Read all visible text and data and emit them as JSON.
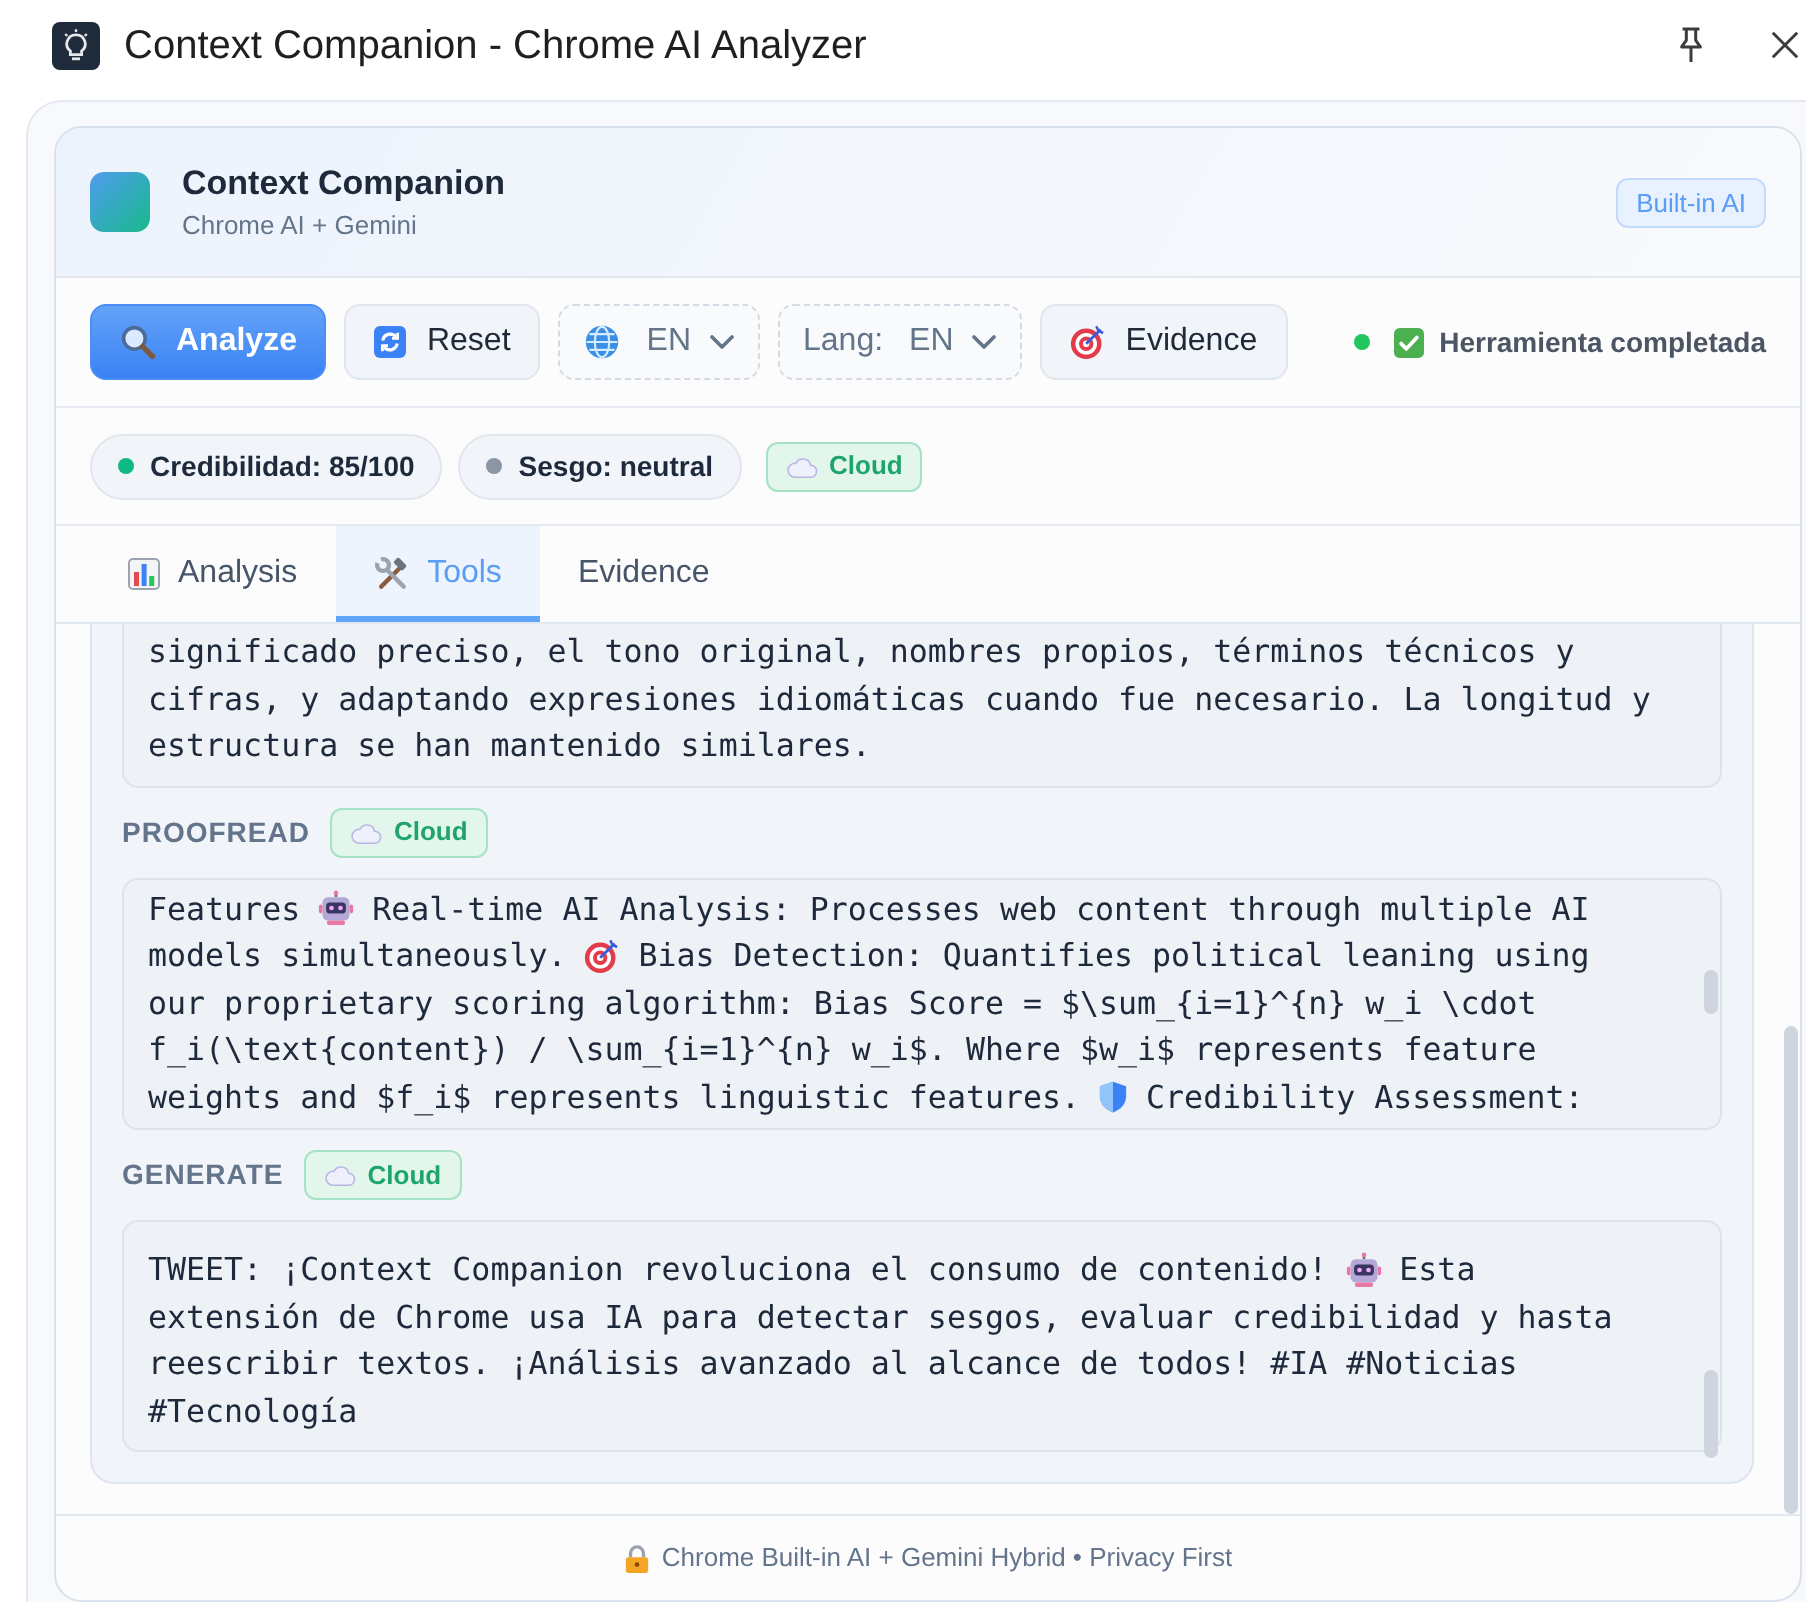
{
  "window": {
    "title": "Context Companion - Chrome AI Analyzer"
  },
  "header": {
    "title": "Context Companion",
    "subtitle": "Chrome AI + Gemini",
    "badge": "Built-in AI"
  },
  "toolbar": {
    "controls": [
      {
        "kind": "primary",
        "label": "Analyze"
      },
      {
        "kind": "button",
        "label": "Reset"
      },
      {
        "kind": "select",
        "value": "EN"
      },
      {
        "kind": "select",
        "label": "Lang:",
        "value": "EN"
      },
      {
        "kind": "button",
        "label": "Evidence"
      }
    ],
    "status": "Herramienta completada"
  },
  "chips": [
    {
      "label": "Credibilidad: 85/100",
      "color": "#10b981"
    },
    {
      "label": "Sesgo: neutral",
      "color": "#8b95a5"
    }
  ],
  "mode_badge": "Cloud",
  "tabs": [
    {
      "label": "Analysis",
      "selected": false
    },
    {
      "label": "Tools",
      "selected": true
    },
    {
      "label": "Evidence",
      "selected": false
    }
  ],
  "tools": [
    {
      "lines": [
        [
          "significado preciso, el tono original, nombres propios, términos técnicos y"
        ],
        [
          "cifras, y adaptando expresiones idiomáticas cuando fue necesario. La longitud y"
        ],
        [
          "estructura se han mantenido similares."
        ]
      ]
    },
    {
      "name": "PROOFREAD",
      "badge": "Cloud",
      "lines": [
        [
          "Features",
          "Real-time AI Analysis: Processes web content through multiple AI"
        ],
        [
          "models simultaneously.",
          "Bias Detection: Quantifies political leaning using"
        ],
        [
          "our proprietary scoring algorithm: Bias Score = $\\sum_{i=1}^{n} w_i \\cdot"
        ],
        [
          "f_i(\\text{content}) / \\sum_{i=1}^{n} w_i$. Where $w_i$ represents feature"
        ],
        [
          "weights and $f_i$ represents linguistic features.",
          "Credibility Assessment:"
        ]
      ]
    },
    {
      "name": "GENERATE",
      "badge": "Cloud",
      "lines": [
        [
          "TWEET: ¡Context Companion revoluciona el consumo de contenido!",
          "Esta"
        ],
        [
          "extensión de Chrome usa IA para detectar sesgos, evaluar credibilidad y hasta"
        ],
        [
          "reescribir textos. ¡Análisis avanzado al alcance de todos! #IA #Noticias"
        ],
        [
          "#Tecnología"
        ]
      ]
    }
  ],
  "footer": "Chrome Built-in AI + Gemini Hybrid • Privacy First"
}
